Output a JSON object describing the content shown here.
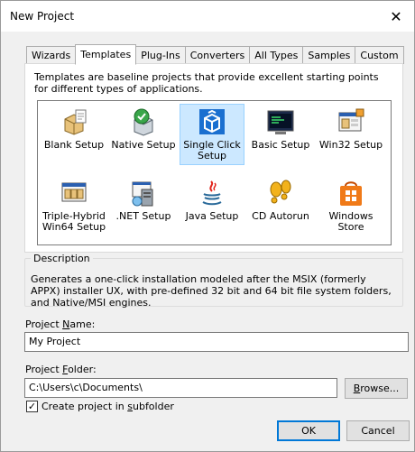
{
  "window": {
    "title": "New Project",
    "close_glyph": "✕"
  },
  "tabs": [
    {
      "label": "Wizards",
      "active": false
    },
    {
      "label": "Templates",
      "active": true
    },
    {
      "label": "Plug-Ins",
      "active": false
    },
    {
      "label": "Converters",
      "active": false
    },
    {
      "label": "All Types",
      "active": false
    },
    {
      "label": "Samples",
      "active": false
    },
    {
      "label": "Custom",
      "active": false
    }
  ],
  "templates": {
    "intro": "Templates are baseline projects that provide excellent starting points for different types of applications.",
    "items": [
      {
        "label": "Blank Setup",
        "icon": "blank-setup-icon"
      },
      {
        "label": "Native Setup",
        "icon": "native-setup-icon"
      },
      {
        "label": "Single Click Setup",
        "icon": "single-click-setup-icon",
        "selected": true
      },
      {
        "label": "Basic Setup",
        "icon": "basic-setup-icon"
      },
      {
        "label": "Win32 Setup",
        "icon": "win32-setup-icon"
      },
      {
        "label": "Triple-Hybrid Win64 Setup",
        "icon": "triple-hybrid-setup-icon"
      },
      {
        "label": ".NET Setup",
        "icon": "dotnet-setup-icon"
      },
      {
        "label": "Java Setup",
        "icon": "java-setup-icon"
      },
      {
        "label": "CD Autorun",
        "icon": "cd-autorun-icon"
      },
      {
        "label": "Windows Store",
        "icon": "windows-store-icon"
      }
    ]
  },
  "description": {
    "legend": "Description",
    "text": "Generates a one-click installation modeled after the MSIX (formerly APPX) installer UX, with pre-defined 32 bit and 64 bit file system folders, and Native/MSI engines."
  },
  "project_name": {
    "label_pre": "Project ",
    "label_u": "N",
    "label_post": "ame:",
    "value": "My Project"
  },
  "project_folder": {
    "label_pre": "Project ",
    "label_u": "F",
    "label_post": "older:",
    "value": "C:\\Users\\c\\Documents\\"
  },
  "browse": {
    "label_u": "B",
    "label_post": "rowse..."
  },
  "subfolder": {
    "checked": true,
    "check_glyph": "✓",
    "label_pre": "Create project in ",
    "label_u": "s",
    "label_post": "ubfolder"
  },
  "buttons": {
    "ok": "OK",
    "cancel": "Cancel"
  },
  "colors": {
    "selection": "#cce8ff",
    "default_button_border": "#0078d7"
  }
}
